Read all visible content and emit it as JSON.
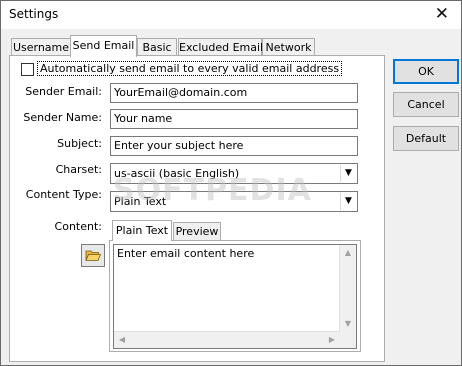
{
  "window": {
    "title": "Settings",
    "close_glyph": "✕"
  },
  "tabs": [
    "Username",
    "Send Email",
    "Basic",
    "Excluded Email",
    "Network"
  ],
  "active_tab": "Send Email",
  "auto_send": {
    "label": "Automatically send email to every valid email address",
    "checked": false
  },
  "form": {
    "sender_email": {
      "label": "Sender Email:",
      "value": "YourEmail@domain.com"
    },
    "sender_name": {
      "label": "Sender Name:",
      "value": "Your name"
    },
    "subject": {
      "label": "Subject:",
      "value": "Enter your subject here"
    },
    "charset": {
      "label": "Charset:",
      "value": "us-ascii (basic English)"
    },
    "content_type": {
      "label": "Content Type:",
      "value": "Plain Text"
    },
    "content": {
      "label": "Content:",
      "value": "Enter email content here"
    }
  },
  "content_tabs": [
    "Plain Text",
    "Preview"
  ],
  "buttons": {
    "ok": "OK",
    "cancel": "Cancel",
    "default": "Default"
  },
  "watermark": "SOFTPEDIA",
  "icons": {
    "combo_arrow": "▼",
    "scroll_up": "▲",
    "scroll_down": "▼",
    "scroll_left": "◀",
    "scroll_right": "▶"
  }
}
